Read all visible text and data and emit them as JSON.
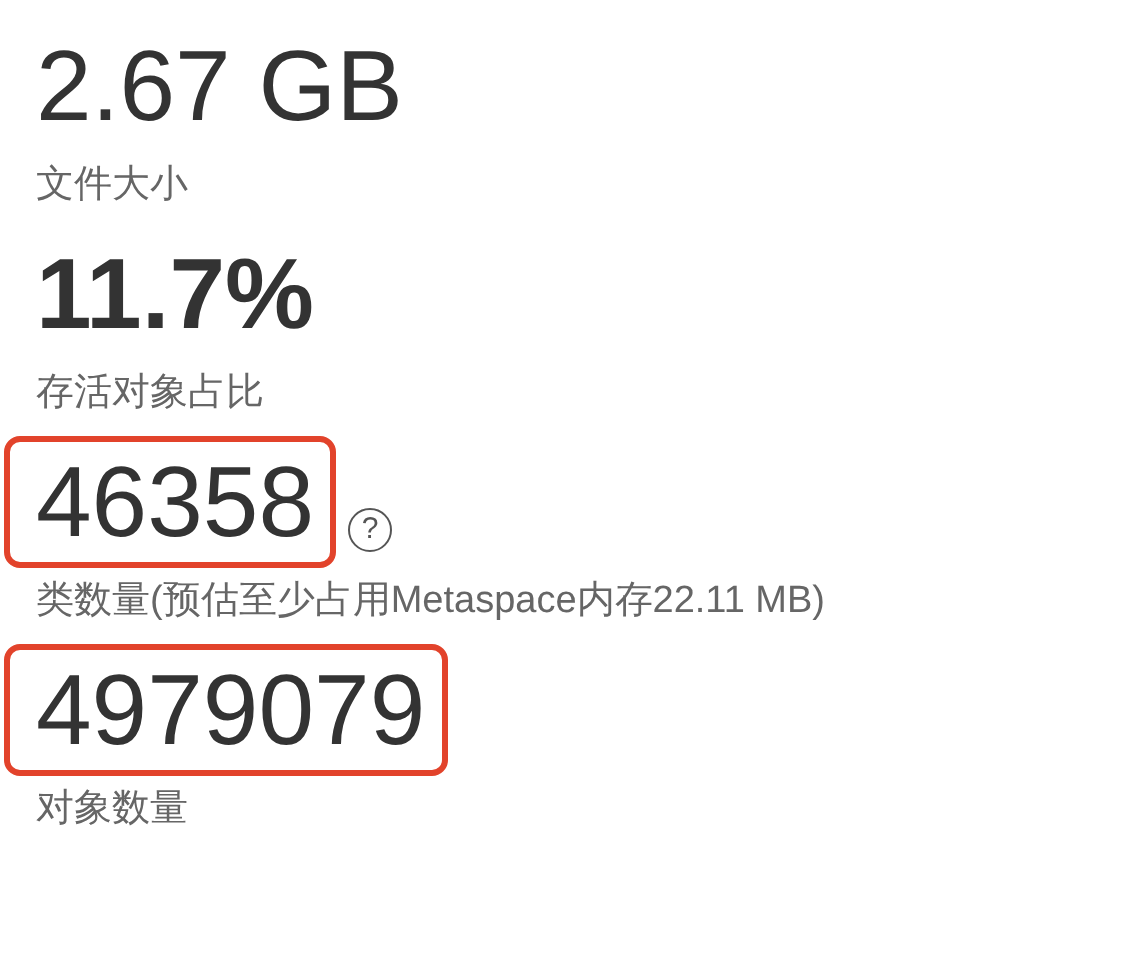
{
  "stats": [
    {
      "value": "2.67 GB",
      "label": "文件大小",
      "bold": false,
      "highlighted": false
    },
    {
      "value": "11.7%",
      "label": "存活对象占比",
      "bold": true,
      "highlighted": false
    },
    {
      "value": "46358",
      "label": "类数量(预估至少占用Metaspace内存22.11 MB)",
      "bold": false,
      "highlighted": true,
      "help": "?"
    },
    {
      "value": "4979079",
      "label": "对象数量",
      "bold": false,
      "highlighted": true
    }
  ]
}
